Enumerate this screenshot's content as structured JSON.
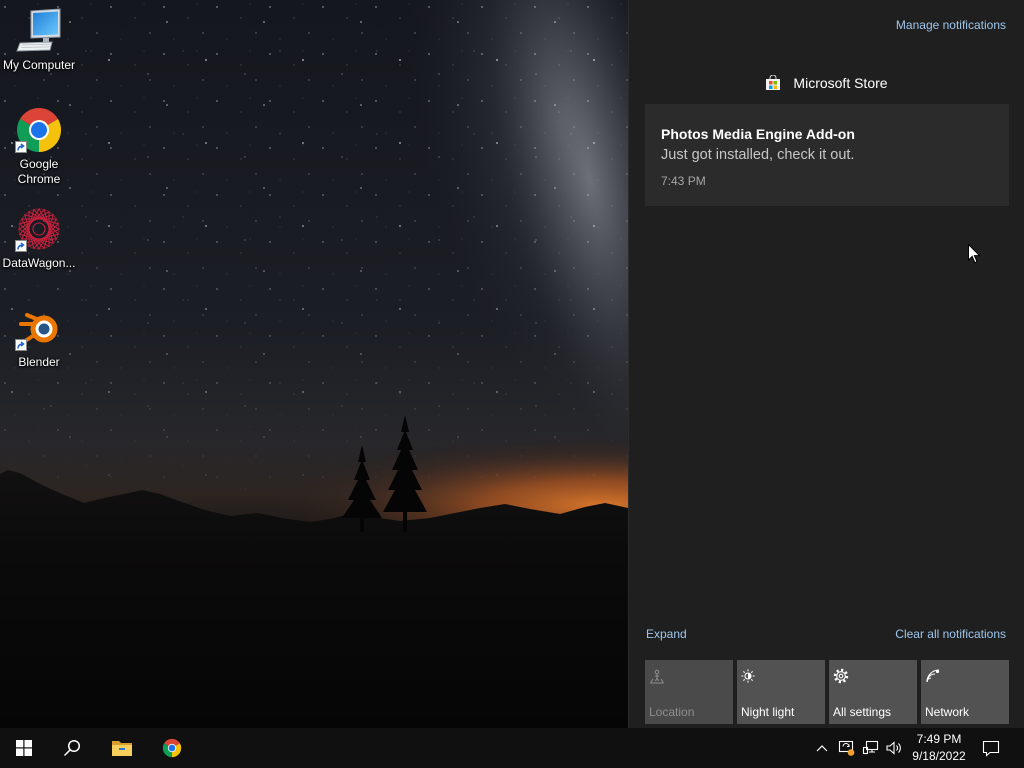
{
  "desktop": {
    "icons": [
      {
        "label": "My Computer",
        "icon": "computer-icon",
        "shortcut": false
      },
      {
        "label": "Google Chrome",
        "icon": "chrome-icon",
        "shortcut": true
      },
      {
        "label": "DataWagon...",
        "icon": "datawagon-icon",
        "shortcut": true
      },
      {
        "label": "Blender",
        "icon": "blender-icon",
        "shortcut": true
      }
    ]
  },
  "action_center": {
    "manage_notifications": "Manage notifications",
    "groups": [
      {
        "app_name": "Microsoft Store",
        "app_icon": "microsoft-store-icon",
        "notifications": [
          {
            "title": "Photos Media Engine Add-on",
            "body": "Just got installed, check it out.",
            "time": "7:43 PM"
          }
        ]
      }
    ],
    "expand": "Expand",
    "clear_all": "Clear all notifications",
    "quick_actions": [
      {
        "label": "Location",
        "icon": "location-icon",
        "enabled": false
      },
      {
        "label": "Night light",
        "icon": "night-light-icon",
        "enabled": true
      },
      {
        "label": "All settings",
        "icon": "settings-gear-icon",
        "enabled": true
      },
      {
        "label": "Network",
        "icon": "network-icon",
        "enabled": true
      }
    ]
  },
  "taskbar": {
    "pinned": [
      {
        "icon": "windows-start-icon"
      },
      {
        "icon": "search-icon"
      },
      {
        "icon": "file-explorer-icon"
      },
      {
        "icon": "chrome-icon"
      }
    ],
    "tray": {
      "icons": [
        "chevron-up-icon",
        "sync-status-icon",
        "network-wired-icon",
        "volume-icon"
      ],
      "time": "7:49 PM",
      "date": "9/18/2022",
      "notification_icon": "action-center-icon"
    }
  },
  "colors": {
    "panel_bg": "#1f1f1f",
    "card_bg": "#2b2b2b",
    "link": "#9ec6ec",
    "tile_bg": "#525252",
    "tile_disabled_bg": "#4a4a4a",
    "taskbar_bg": "#101010",
    "horizon_orange": "#e07a2c"
  }
}
